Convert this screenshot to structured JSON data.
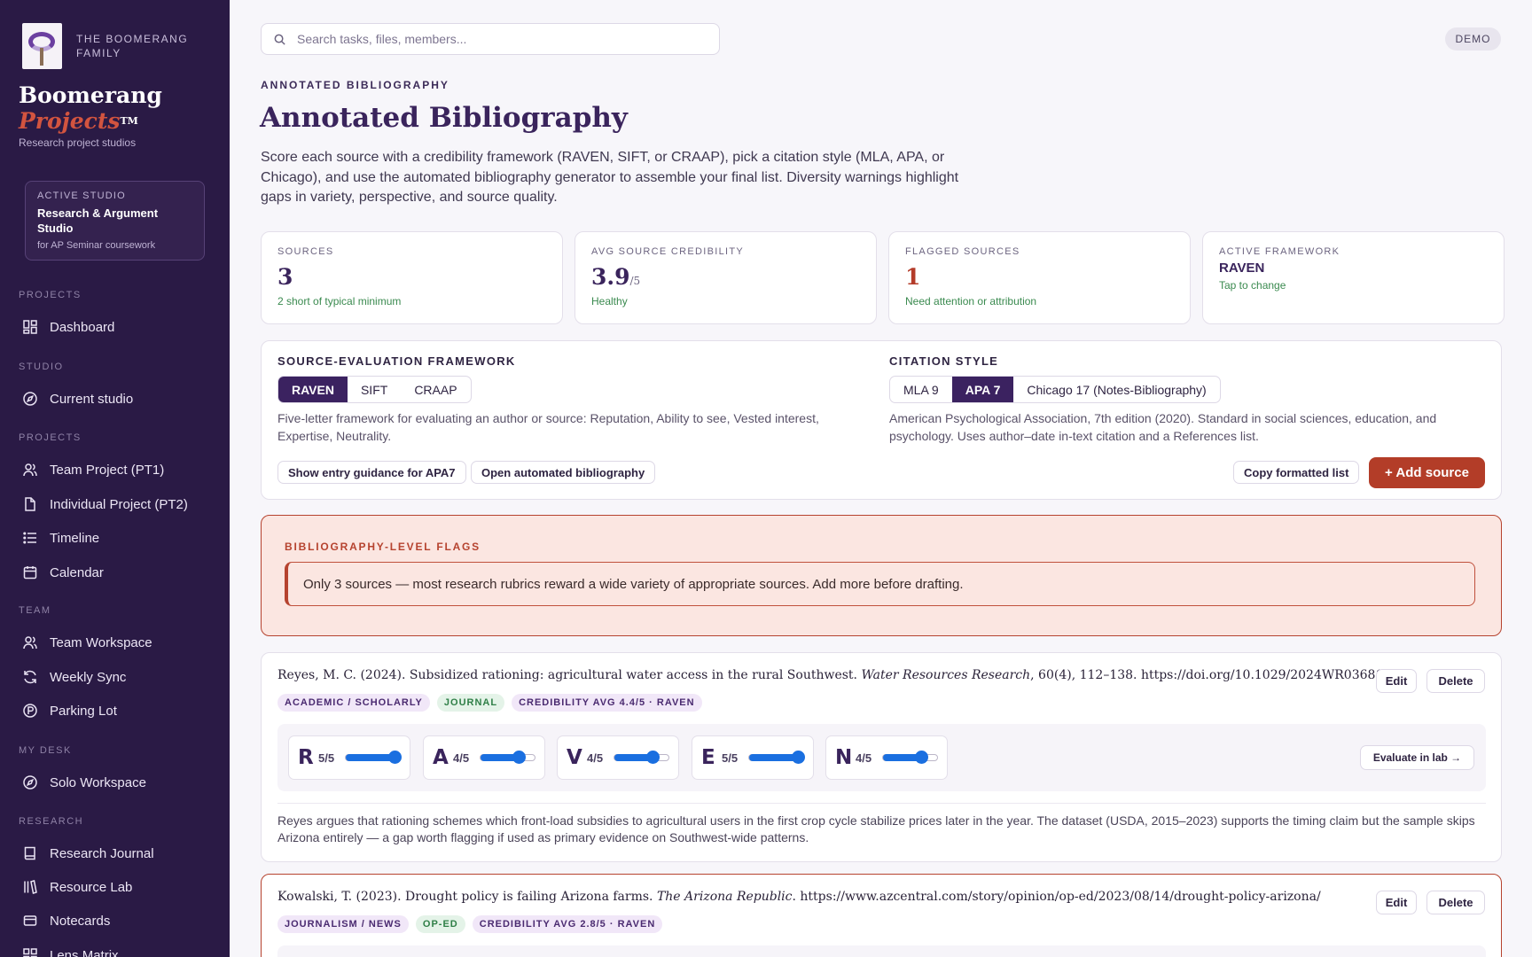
{
  "sidebar": {
    "family": "THE BOOMERANG FAMILY",
    "brand_line1": "Boomerang",
    "brand_line2": "Projects",
    "brand_tm": "TM",
    "tagline": "Research project studios",
    "studio": {
      "kicker": "ACTIVE STUDIO",
      "title": "Research & Argument Studio",
      "sub": "for AP Seminar coursework"
    },
    "sections": [
      {
        "label": "PROJECTS",
        "items": [
          {
            "label": "Dashboard",
            "icon": "grid-icon"
          }
        ]
      },
      {
        "label": "STUDIO",
        "items": [
          {
            "label": "Current studio",
            "icon": "compass-icon"
          }
        ]
      },
      {
        "label": "PROJECTS",
        "items": [
          {
            "label": "Team Project (PT1)",
            "icon": "users-icon"
          },
          {
            "label": "Individual Project (PT2)",
            "icon": "file-icon"
          },
          {
            "label": "Timeline",
            "icon": "list-icon"
          },
          {
            "label": "Calendar",
            "icon": "calendar-icon"
          }
        ]
      },
      {
        "label": "TEAM",
        "items": [
          {
            "label": "Team Workspace",
            "icon": "users-icon"
          },
          {
            "label": "Weekly Sync",
            "icon": "refresh-icon"
          },
          {
            "label": "Parking Lot",
            "icon": "parking-icon"
          }
        ]
      },
      {
        "label": "MY DESK",
        "items": [
          {
            "label": "Solo Workspace",
            "icon": "compass-icon"
          }
        ]
      },
      {
        "label": "RESEARCH",
        "items": [
          {
            "label": "Research Journal",
            "icon": "book-icon"
          },
          {
            "label": "Resource Lab",
            "icon": "library-icon"
          },
          {
            "label": "Notecards",
            "icon": "card-icon"
          },
          {
            "label": "Lens Matrix",
            "icon": "grid-icon"
          }
        ]
      }
    ]
  },
  "header": {
    "search_placeholder": "Search tasks, files, members...",
    "badge": "DEMO"
  },
  "page": {
    "eyebrow": "ANNOTATED BIBLIOGRAPHY",
    "title": "Annotated Bibliography",
    "lede": "Score each source with a credibility framework (RAVEN, SIFT, or CRAAP), pick a citation style (MLA, APA, or Chicago), and use the automated bibliography generator to assemble your final list. Diversity warnings highlight gaps in variety, perspective, and source quality."
  },
  "stats": {
    "sources": {
      "label": "SOURCES",
      "value": "3",
      "note": "2 short of typical minimum"
    },
    "credibility": {
      "label": "AVG SOURCE CREDIBILITY",
      "value": "3.9",
      "unit": "/5",
      "note": "Healthy"
    },
    "flagged": {
      "label": "FLAGGED SOURCES",
      "value": "1",
      "note": "Need attention or attribution"
    },
    "framework": {
      "label": "ACTIVE FRAMEWORK",
      "value": "RAVEN",
      "note": "Tap to change"
    }
  },
  "framework_panel": {
    "label": "SOURCE-EVALUATION FRAMEWORK",
    "options": [
      "RAVEN",
      "SIFT",
      "CRAAP"
    ],
    "selected": "RAVEN",
    "desc": "Five-letter framework for evaluating an author or source: Reputation, Ability to see, Vested interest, Expertise, Neutrality.",
    "guidance_btn": "Show entry guidance for APA7",
    "auto_btn": "Open automated bibliography"
  },
  "citation_panel": {
    "label": "CITATION STYLE",
    "options": [
      "MLA 9",
      "APA 7",
      "Chicago 17 (Notes-Bibliography)"
    ],
    "selected": "APA 7",
    "desc": "American Psychological Association, 7th edition (2020). Standard in social sciences, education, and psychology. Uses author–date in-text citation and a References list.",
    "copy_btn": "Copy formatted list",
    "add_btn": "+ Add source"
  },
  "flags": {
    "label": "BIBLIOGRAPHY-LEVEL FLAGS",
    "message": "Only 3 sources — most research rubrics reward a wide variety of appropriate sources. Add more before drafting."
  },
  "sources": [
    {
      "cite_pre": "Reyes, M. C. (2024). Subsidized rationing: agricultural water access in the rural Southwest. ",
      "cite_journal": "Water Resources Research",
      "cite_post": ", 60(4), 112–138. https://doi.org/10.1029/2024WR036812",
      "tags": [
        "ACADEMIC / SCHOLARLY",
        "JOURNAL",
        "CREDIBILITY AVG 4.4/5 · RAVEN"
      ],
      "scores": [
        {
          "letter": "R",
          "score": 5,
          "max": 5
        },
        {
          "letter": "A",
          "score": 4,
          "max": 5
        },
        {
          "letter": "V",
          "score": 4,
          "max": 5
        },
        {
          "letter": "E",
          "score": 5,
          "max": 5
        },
        {
          "letter": "N",
          "score": 4,
          "max": 5
        }
      ],
      "eval_btn": "Evaluate in lab →",
      "annotation": "Reyes argues that rationing schemes which front-load subsidies to agricultural users in the first crop cycle stabilize prices later in the year. The dataset (USDA, 2015–2023) supports the timing claim but the sample skips Arizona entirely — a gap worth flagging if used as primary evidence on Southwest-wide patterns."
    },
    {
      "cite_pre": "Kowalski, T. (2023). Drought policy is failing Arizona farms. ",
      "cite_journal": "The Arizona Republic",
      "cite_post": ". https://www.azcentral.com/story/opinion/op-ed/2023/08/14/drought-policy-arizona/",
      "tags": [
        "JOURNALISM / NEWS",
        "OP-ED",
        "CREDIBILITY AVG 2.8/5 · RAVEN"
      ]
    }
  ],
  "actions": {
    "edit": "Edit",
    "delete": "Delete"
  },
  "colors": {
    "sidebar": "#2a1a45",
    "accent": "#b33d28",
    "primary": "#3b2260",
    "slider": "#1a6fe0"
  }
}
